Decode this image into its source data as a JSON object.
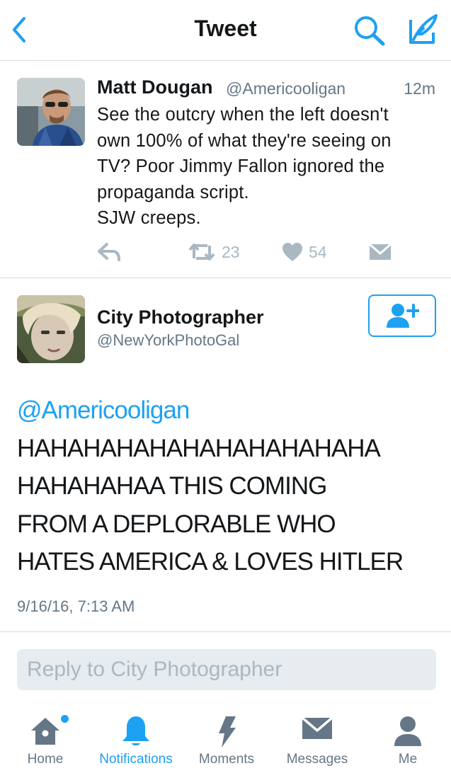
{
  "colors": {
    "accent": "#1da1f2",
    "text_primary": "#14171a",
    "text_secondary": "#657786",
    "icon_muted": "#aab8c2",
    "divider": "#d7dbdf",
    "input_bg": "#e6ecf0"
  },
  "navbar": {
    "title": "Tweet",
    "back_icon": "chevron-left-icon",
    "search_icon": "search-icon",
    "compose_icon": "compose-quill-icon"
  },
  "parent_tweet": {
    "name": "Matt Dougan",
    "handle": "@Americooligan",
    "time": "12m",
    "text": "See the outcry when the left doesn't\nown 100% of what they're seeing on\nTV? Poor Jimmy Fallon ignored the\npropaganda script.\nSJW creeps.",
    "actions": {
      "reply_icon": "reply-icon",
      "retweet_icon": "retweet-icon",
      "retweet_count": "23",
      "like_icon": "heart-icon",
      "like_count": "54",
      "dm_icon": "direct-message-icon"
    }
  },
  "main_tweet": {
    "name": "City Photographer",
    "handle": "@NewYorkPhotoGal",
    "follow_icon": "follow-user-icon",
    "mention": "@Americooligan",
    "text": "HAHAHAHAHAHAHAHAHAHAHA\nHAHAHAHAA THIS COMING\nFROM A DEPLORABLE WHO\nHATES AMERICA & LOVES HITLER",
    "date": "9/16/16, 7:13 AM"
  },
  "reply": {
    "placeholder": "Reply to City Photographer"
  },
  "tabbar": {
    "tabs": [
      {
        "label": "Home",
        "icon": "home-icon",
        "has_dot": true,
        "active": false
      },
      {
        "label": "Notifications",
        "icon": "bell-icon",
        "active": true
      },
      {
        "label": "Moments",
        "icon": "lightning-icon",
        "active": false
      },
      {
        "label": "Messages",
        "icon": "envelope-icon",
        "active": false
      },
      {
        "label": "Me",
        "icon": "person-icon",
        "active": false
      }
    ]
  }
}
